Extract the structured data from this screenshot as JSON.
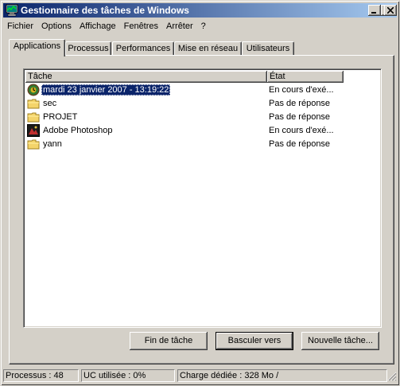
{
  "window": {
    "title": "Gestionnaire des tâches de Windows",
    "icon": "task-manager-icon"
  },
  "menu": [
    {
      "label": "Fichier"
    },
    {
      "label": "Options"
    },
    {
      "label": "Affichage"
    },
    {
      "label": "Fenêtres"
    },
    {
      "label": "Arrêter"
    },
    {
      "label": "?"
    }
  ],
  "tabs": [
    {
      "label": "Applications",
      "active": true
    },
    {
      "label": "Processus"
    },
    {
      "label": "Performances"
    },
    {
      "label": "Mise en réseau"
    },
    {
      "label": "Utilisateurs"
    }
  ],
  "list": {
    "columns": [
      "Tâche",
      "État"
    ],
    "rows": [
      {
        "name": "mardi 23 janvier 2007 - 13:19:22",
        "status": "En cours d'exé...",
        "icon": "clock-app-icon",
        "selected": true
      },
      {
        "name": "sec",
        "status": "Pas de réponse",
        "icon": "folder-icon"
      },
      {
        "name": "PROJET",
        "status": "Pas de réponse",
        "icon": "folder-icon"
      },
      {
        "name": "Adobe Photoshop",
        "status": "En cours d'exé...",
        "icon": "photoshop-icon"
      },
      {
        "name": "yann",
        "status": "Pas de réponse",
        "icon": "folder-icon"
      }
    ]
  },
  "buttons": {
    "end_task": "Fin de tâche",
    "switch_to": "Basculer vers",
    "new_task": "Nouvelle tâche..."
  },
  "statusbar": {
    "processes": "Processus : 48",
    "cpu": "UC utilisée : 0%",
    "commit": "Charge dédiée : 328 Mo /"
  },
  "colors": {
    "title_start": "#0a246a",
    "title_end": "#a6caf0",
    "face": "#d4d0c8",
    "selection": "#0a246a"
  }
}
